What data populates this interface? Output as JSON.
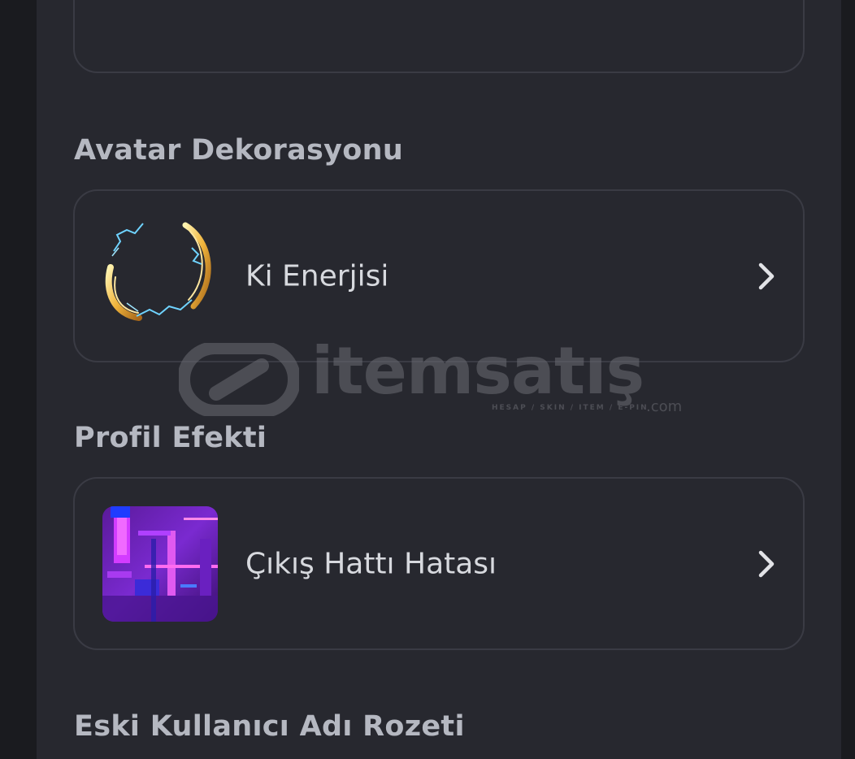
{
  "sections": {
    "avatar_decoration": {
      "title": "Avatar Dekorasyonu",
      "item_label": "Ki Enerjisi"
    },
    "profile_effect": {
      "title": "Profil Efekti",
      "item_label": "Çıkış Hattı Hatası"
    },
    "legacy_username_badge": {
      "title": "Eski Kullanıcı Adı Rozeti"
    }
  },
  "watermark": {
    "brand": "itemsatış",
    "tagline": "HESAP / SKIN / ITEM / E-PIN",
    "suffix": ".com"
  },
  "colors": {
    "background": "#1a1b1f",
    "panel": "#27282f",
    "card_border": "#3a3b44",
    "title_text": "#b5b8c1",
    "item_text": "#d7d9de"
  }
}
